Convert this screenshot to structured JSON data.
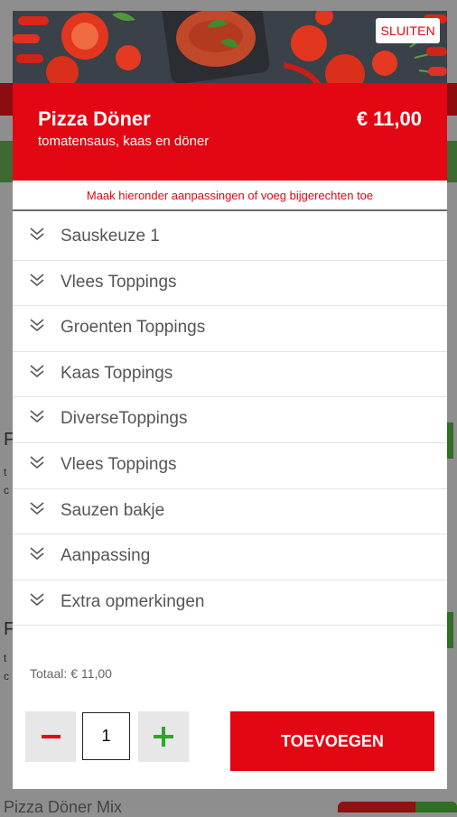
{
  "modal": {
    "close_label": "SLUITEN",
    "product": {
      "name": "Pizza Döner",
      "description": "tomatensaus, kaas en döner",
      "price": "€ 11,00"
    },
    "hint": "Maak hieronder aanpassingen of voeg bijgerechten toe",
    "options": [
      {
        "label": "Sauskeuze 1"
      },
      {
        "label": "Vlees Toppings"
      },
      {
        "label": "Groenten Toppings"
      },
      {
        "label": "Kaas Toppings"
      },
      {
        "label": "DiverseToppings"
      },
      {
        "label": "Vlees Toppings"
      },
      {
        "label": "Sauzen bakje"
      },
      {
        "label": "Aanpassing"
      },
      {
        "label": "Extra opmerkingen"
      }
    ],
    "total_label": "Totaal:",
    "total_value": "€ 11,00",
    "quantity": "1",
    "add_label": "TOEVOEGEN"
  },
  "background": {
    "partial_texts": [
      "F",
      "t",
      "c",
      "F",
      "t",
      "c",
      "Pizza Döner Mix"
    ]
  },
  "colors": {
    "accent": "#e30613",
    "plus": "#2fa62a",
    "text_gray": "#555555"
  }
}
